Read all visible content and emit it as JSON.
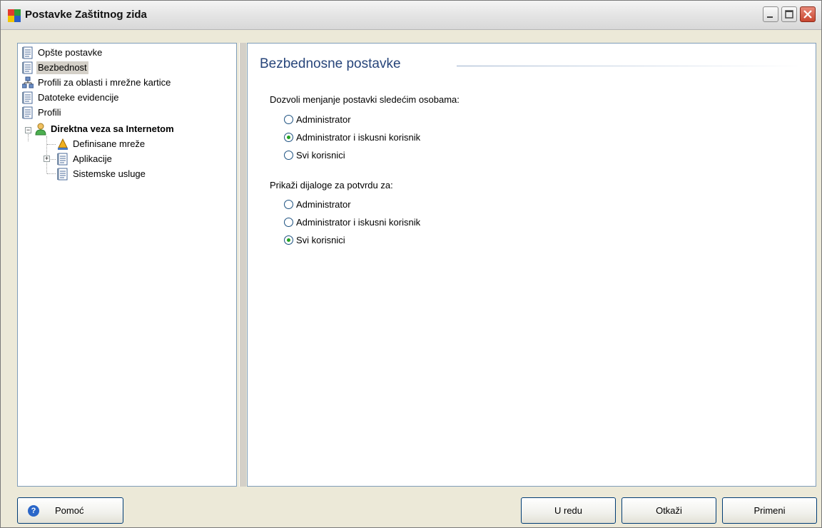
{
  "window": {
    "title": "Postavke Zaštitnog zida",
    "controls": [
      "minimize",
      "maximize",
      "close"
    ]
  },
  "tree": {
    "items": [
      {
        "label": "Opšte postavke",
        "icon": "document-icon"
      },
      {
        "label": "Bezbednost",
        "icon": "document-icon",
        "selected": true
      },
      {
        "label": "Profili za oblasti i mrežne kartice",
        "icon": "network-icon"
      },
      {
        "label": "Datoteke evidencije",
        "icon": "document-icon"
      },
      {
        "label": "Profili",
        "icon": "document-icon"
      },
      {
        "label": "Direktna veza sa Internetom",
        "icon": "user-icon",
        "bold": true,
        "expanded": true
      },
      {
        "label": "Definisane mreže",
        "icon": "network-icon"
      },
      {
        "label": "Aplikacije",
        "icon": "document-icon",
        "collapsed": true
      },
      {
        "label": "Sistemske usluge",
        "icon": "document-icon"
      }
    ]
  },
  "panel": {
    "title": "Bezbednosne postavke",
    "group1": {
      "label": "Dozvoli menjanje postavki sledećim osobama:",
      "options": [
        "Administrator",
        "Administrator i iskusni korisnik",
        "Svi korisnici"
      ],
      "selected": "Administrator i iskusni korisnik"
    },
    "group2": {
      "label": "Prikaži dijaloge za potvrdu za:",
      "options": [
        "Administrator",
        "Administrator i iskusni korisnik",
        "Svi korisnici"
      ],
      "selected": "Svi korisnici"
    }
  },
  "buttons": {
    "help": "Pomoć",
    "ok": "U redu",
    "cancel": "Otkaži",
    "apply": "Primeni"
  },
  "colors": {
    "title_blue": "#27457a",
    "radio_check": "#21a121",
    "border_blue": "#7f9db9"
  }
}
